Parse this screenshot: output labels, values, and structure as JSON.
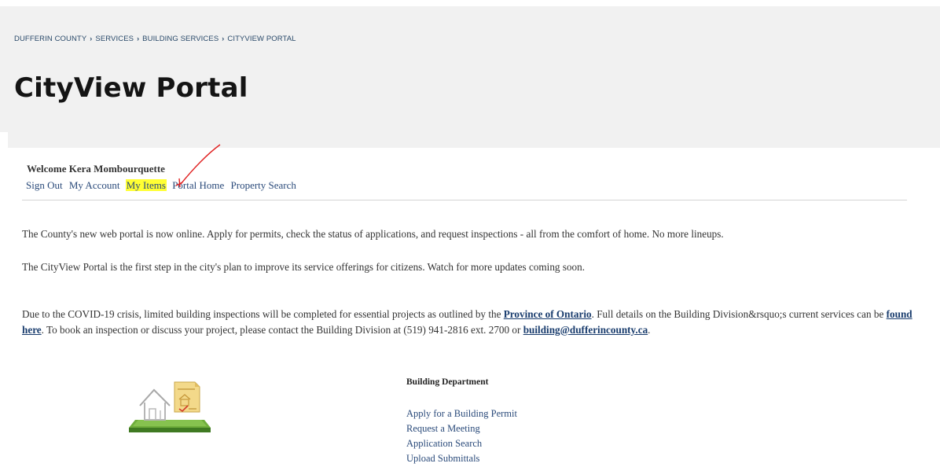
{
  "breadcrumb": {
    "items": [
      "DUFFERIN COUNTY",
      "SERVICES",
      "BUILDING SERVICES",
      "CITYVIEW PORTAL"
    ],
    "separator": "›"
  },
  "page": {
    "title": "CityView Portal"
  },
  "user": {
    "welcome": "Welcome Kera Mombourquette",
    "links": [
      "Sign Out",
      "My Account",
      "My Items",
      "Portal Home",
      "Property Search"
    ],
    "highlighted_link": "My Items"
  },
  "content": {
    "p1": "The County's new web portal is now online. Apply for permits, check the status of applications, and request inspections - all from the comfort of home. No more lineups.",
    "p2": "The CityView Portal is the first step in the city's plan to improve its service offerings for citizens. Watch for more updates coming soon.",
    "p3": {
      "part1": "Due to the COVID-19 crisis, limited building inspections will be completed for essential projects as outlined by the ",
      "link1": "Province of Ontario",
      "part2": ". Full details on the Building Division&rsquo;s current services can be ",
      "link2": "found here",
      "part3": ". To book an inspection or discuss your project, please contact the Building Division at (519) 941-2816 ext. 2700 or ",
      "link3": "building@dufferincounty.ca",
      "part4": "."
    }
  },
  "department": {
    "title": "Building Department",
    "links": [
      "Apply for a Building Permit",
      "Request a Meeting",
      "Application Search",
      "Upload Submittals"
    ]
  },
  "colors": {
    "hero_bg": "#f1f1f1",
    "link": "#2a4a7a",
    "highlight": "#ffff33",
    "annotation_arrow": "#e02020"
  },
  "icons": {
    "department": "house-permit-icon",
    "annotation": "red-arrow-icon"
  }
}
